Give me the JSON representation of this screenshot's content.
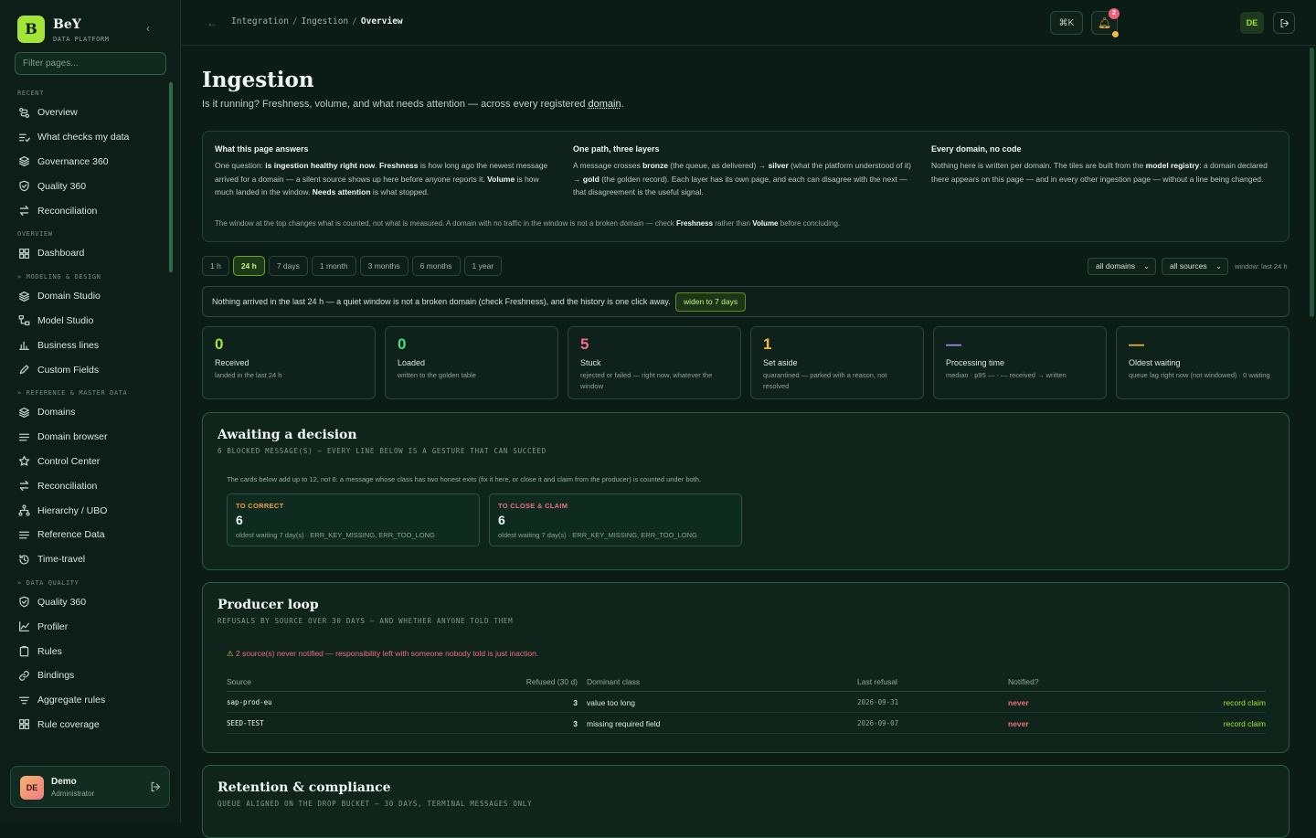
{
  "brand": {
    "logo_letter": "B",
    "name": "BeY",
    "subtitle": "DATA PLATFORM"
  },
  "sidebar": {
    "filter_placeholder": "Filter pages...",
    "groups": [
      {
        "label": "RECENT",
        "items": [
          {
            "label": "Overview",
            "icon": "route-icon"
          },
          {
            "label": "What checks my data",
            "icon": "checklist-icon"
          },
          {
            "label": "Governance 360",
            "icon": "layers-icon"
          },
          {
            "label": "Quality 360",
            "icon": "shield-check-icon"
          },
          {
            "label": "Reconciliation",
            "icon": "arrows-swap-icon"
          }
        ]
      },
      {
        "label": "OVERVIEW",
        "items": [
          {
            "label": "Dashboard",
            "icon": "grid-icon"
          }
        ]
      },
      {
        "label": "» MODELING & DESIGN",
        "items": [
          {
            "label": "Domain Studio",
            "icon": "layers-icon"
          },
          {
            "label": "Model Studio",
            "icon": "nodes-icon"
          },
          {
            "label": "Business lines",
            "icon": "bar-chart-icon"
          },
          {
            "label": "Custom Fields",
            "icon": "pencil-icon"
          }
        ]
      },
      {
        "label": "» REFERENCE & MASTER DATA",
        "items": [
          {
            "label": "Domains",
            "icon": "layers-icon"
          },
          {
            "label": "Domain browser",
            "icon": "list-icon"
          },
          {
            "label": "Control Center",
            "icon": "star-icon"
          },
          {
            "label": "Reconciliation",
            "icon": "arrows-swap-icon"
          },
          {
            "label": "Hierarchy / UBO",
            "icon": "hierarchy-icon"
          },
          {
            "label": "Reference Data",
            "icon": "list-icon"
          },
          {
            "label": "Time-travel",
            "icon": "history-icon"
          }
        ]
      },
      {
        "label": "» DATA QUALITY",
        "items": [
          {
            "label": "Quality 360",
            "icon": "shield-check-icon"
          },
          {
            "label": "Profiler",
            "icon": "line-chart-icon"
          },
          {
            "label": "Rules",
            "icon": "clipboard-icon"
          },
          {
            "label": "Bindings",
            "icon": "link-icon"
          },
          {
            "label": "Aggregate rules",
            "icon": "filter-icon"
          },
          {
            "label": "Rule coverage",
            "icon": "grid-icon"
          }
        ]
      }
    ]
  },
  "user": {
    "initials": "DE",
    "name": "Demo",
    "role": "Administrator"
  },
  "topbar": {
    "breadcrumb": [
      "Integration",
      "Ingestion",
      "Overview"
    ],
    "cmd_label": "⌘K",
    "notifications": "2",
    "user_initials": "DE"
  },
  "page": {
    "title": "Ingestion",
    "lede_before": "Is it running? Freshness, volume, and what needs attention — across every registered ",
    "lede_link": "domain",
    "lede_after": "."
  },
  "intro": {
    "columns": [
      {
        "title": "What this page answers",
        "parts": [
          [
            "One question: ",
            false
          ],
          [
            "is ingestion healthy right now",
            true
          ],
          [
            ". ",
            false
          ],
          [
            "Freshness",
            true
          ],
          [
            " is how long ago the newest message arrived for a domain — a silent source shows up here before anyone reports it. ",
            false
          ],
          [
            "Volume",
            true
          ],
          [
            " is how much landed in the window. ",
            false
          ],
          [
            "Needs attention",
            true
          ],
          [
            " is what stopped.",
            false
          ]
        ]
      },
      {
        "title": "One path, three layers",
        "parts": [
          [
            "A message crosses ",
            false
          ],
          [
            "bronze",
            true
          ],
          [
            " (the queue, as delivered) → ",
            false
          ],
          [
            "silver",
            true
          ],
          [
            " (what the platform understood of it) → ",
            false
          ],
          [
            "gold",
            true
          ],
          [
            " (the golden record). Each layer has its own page, and each can disagree with the next — that disagreement is the useful signal.",
            false
          ]
        ]
      },
      {
        "title": "Every domain, no code",
        "parts": [
          [
            "Nothing here is written per domain. The tiles are built from the ",
            false
          ],
          [
            "model registry",
            true
          ],
          [
            ": a domain declared there appears on this page — and in every other ingestion page — without a line being changed.",
            false
          ]
        ]
      }
    ],
    "footer_parts": [
      [
        "The window at the top changes what is counted, not what is measured. A domain with no traffic in the window is not a broken domain — check ",
        false
      ],
      [
        "Freshness",
        true
      ],
      [
        " rather than ",
        false
      ],
      [
        "Volume",
        true
      ],
      [
        " before concluding.",
        false
      ]
    ]
  },
  "ranges": {
    "options": [
      "1 h",
      "24 h",
      "7 days",
      "1 month",
      "3 months",
      "6 months",
      "1 year"
    ],
    "selected": "24 h"
  },
  "filters": {
    "domain": "all domains",
    "source": "all sources",
    "window_label": "window: last 24 h"
  },
  "banner": {
    "text": "Nothing arrived in the last 24 h — a quiet window is not a broken domain (check Freshness), and the history is one click away.",
    "button": "widen to 7 days"
  },
  "tiles": [
    {
      "value": "0",
      "label": "Received",
      "sub": "landed in the last 24 h",
      "color": "#a3e635"
    },
    {
      "value": "0",
      "label": "Loaded",
      "sub": "written to the golden table",
      "color": "#4ade80"
    },
    {
      "value": "5",
      "label": "Stuck",
      "sub": "rejected or failed — right now, whatever the window",
      "color": "#f26d8c"
    },
    {
      "value": "1",
      "label": "Set aside",
      "sub": "quarantined — parked with a reason, not resolved",
      "color": "#f5b942"
    },
    {
      "value": "—",
      "label": "Processing time",
      "sub": "median · p95 — · — received → written",
      "color": "#a78bfa"
    },
    {
      "value": "—",
      "label": "Oldest waiting",
      "sub": "queue lag right now (not windowed) · 0 waiting",
      "color": "#f5b942"
    }
  ],
  "awaiting": {
    "title": "Awaiting a decision",
    "subtitle": "6 BLOCKED MESSAGE(S) — EVERY LINE BELOW IS A GESTURE THAT CAN SUCCEED",
    "note": "The cards below add up to 12, not 6: a message whose class has two honest exits (fix it here, or close it and claim from the producer) is counted under both.",
    "cards": [
      {
        "title": "TO CORRECT",
        "value": "6",
        "detail": "oldest waiting 7 day(s) · ERR_KEY_MISSING, ERR_TOO_LONG",
        "color": "#f59e42"
      },
      {
        "title": "TO CLOSE & CLAIM",
        "value": "6",
        "detail": "oldest waiting 7 day(s) · ERR_KEY_MISSING, ERR_TOO_LONG",
        "color": "#f26d8c"
      }
    ]
  },
  "producer": {
    "title": "Producer loop",
    "subtitle": "REFUSALS BY SOURCE OVER 30 DAYS — AND WHETHER ANYONE TOLD THEM",
    "warning": "2 source(s) never notified — responsibility left with someone nobody told is just inaction.",
    "columns": [
      "Source",
      "Refused (30 d)",
      "Dominant class",
      "Last refusal",
      "Notified?"
    ],
    "rows": [
      {
        "source": "sap-prod-eu",
        "refused": "3",
        "class": "value too long",
        "last": "2026-09-31",
        "notified": "never",
        "action": "record claim"
      },
      {
        "source": "SEED-TEST",
        "refused": "3",
        "class": "missing required field",
        "last": "2026-09-07",
        "notified": "never",
        "action": "record claim"
      }
    ]
  },
  "retention": {
    "title": "Retention & compliance",
    "subtitle": "QUEUE ALIGNED ON THE DROP BUCKET — 30 DAYS, TERMINAL MESSAGES ONLY"
  }
}
